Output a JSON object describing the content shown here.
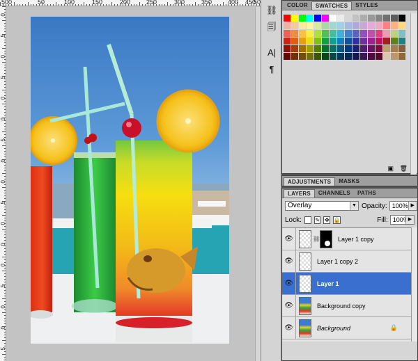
{
  "ruler": {
    "top_labels": [
      "50",
      "0",
      "50",
      "100",
      "150",
      "200",
      "250",
      "300",
      "350",
      "400",
      "450",
      "500"
    ],
    "left_labels": [
      "0",
      "5",
      "0",
      "5",
      "0",
      "0",
      "5",
      "0",
      "0",
      "5",
      "0",
      "0",
      "0",
      "5",
      "0",
      "0",
      "5"
    ]
  },
  "tools": {
    "icons": [
      "clone-source-icon",
      "brush-presets-icon",
      "character-icon",
      "paragraph-icon"
    ],
    "glyphs": [
      "⛓",
      "🗐",
      "A|",
      "¶"
    ]
  },
  "swatches_panel": {
    "tabs": [
      "COLOR",
      "SWATCHES",
      "STYLES"
    ],
    "active_tab": "SWATCHES",
    "colors": [
      "#ff0000",
      "#ffff00",
      "#00ff00",
      "#00ffff",
      "#0000ff",
      "#ff00ff",
      "#ffffff",
      "#ebebeb",
      "#d6d6d6",
      "#c2c2c2",
      "#adadad",
      "#999999",
      "#858585",
      "#707070",
      "#5c5c5c",
      "#000000",
      "#f0b0a8",
      "#f6c8a0",
      "#fce8a0",
      "#fdf6a0",
      "#d8eaa0",
      "#a8d8a8",
      "#a0d8d0",
      "#a0d0e8",
      "#a8b8e0",
      "#b0a8d8",
      "#c8a8d8",
      "#e8a8d8",
      "#f0a8c0",
      "#ff8080",
      "#ffb080",
      "#ffd880",
      "#f06050",
      "#f08a40",
      "#f8c040",
      "#f8f040",
      "#b0e040",
      "#50c050",
      "#40c0a0",
      "#40b0e0",
      "#4080d0",
      "#6060c0",
      "#9050c0",
      "#c050a8",
      "#e04080",
      "#e8a0b0",
      "#c0d080",
      "#80c0c0",
      "#d02010",
      "#e06010",
      "#e8a010",
      "#e8e010",
      "#80c010",
      "#10a040",
      "#10a090",
      "#1080c0",
      "#1050a0",
      "#3030a0",
      "#7030a0",
      "#a02090",
      "#c01060",
      "#a02020",
      "#608020",
      "#208080",
      "#901008",
      "#a04008",
      "#a07008",
      "#a0a008",
      "#508008",
      "#087030",
      "#087060",
      "#085880",
      "#083880",
      "#202070",
      "#502070",
      "#701060",
      "#800840",
      "#c0a070",
      "#a08050",
      "#806040",
      "#600808",
      "#703008",
      "#705008",
      "#707008",
      "#385808",
      "#084818",
      "#084840",
      "#083858",
      "#082858",
      "#181850",
      "#381850",
      "#500840",
      "#58082c",
      "#d8c8b0",
      "#b89870",
      "#906838"
    ]
  },
  "adjustments_panel": {
    "tabs": [
      "ADJUSTMENTS",
      "MASKS"
    ],
    "active_tab": "ADJUSTMENTS"
  },
  "layers_panel": {
    "tabs": [
      "LAYERS",
      "CHANNELS",
      "PATHS"
    ],
    "active_tab": "LAYERS",
    "blend_mode": "Overlay",
    "opacity_label": "Opacity:",
    "opacity_value": "100%",
    "lock_label": "Lock:",
    "fill_label": "Fill:",
    "fill_value": "100%",
    "layers": [
      {
        "name": "Layer 1 copy",
        "visible": true,
        "has_mask": true,
        "selected": false,
        "italic": false,
        "locked": false
      },
      {
        "name": "Layer 1 copy 2",
        "visible": true,
        "has_mask": false,
        "selected": false,
        "italic": false,
        "locked": false
      },
      {
        "name": "Layer 1",
        "visible": true,
        "has_mask": false,
        "selected": true,
        "italic": false,
        "locked": false
      },
      {
        "name": "Background copy",
        "visible": true,
        "has_mask": false,
        "selected": false,
        "italic": false,
        "locked": false,
        "photo": true
      },
      {
        "name": "Background",
        "visible": true,
        "has_mask": false,
        "selected": false,
        "italic": true,
        "locked": true,
        "photo": true
      }
    ]
  },
  "colors": {
    "selection": "#3a6fd0",
    "sky": "#3f7fc8",
    "yellow_drink": "#f0d210",
    "green_drink": "#28a83c",
    "red_drink": "#e03a18",
    "lemon": "#f5c420"
  }
}
